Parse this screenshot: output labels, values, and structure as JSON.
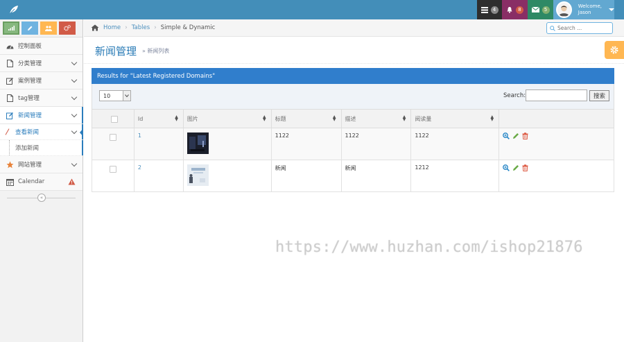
{
  "navbar": {
    "tasks_count": "4",
    "notifications_count": "8",
    "messages_count": "5",
    "welcome_label": "Welcome,",
    "user_name": "Jason",
    "colors": {
      "bar": "#438eb9",
      "tasks": "#2e2e2e",
      "notifications": "#892e65",
      "messages": "#2e8965",
      "user": "#62a8d1"
    }
  },
  "sidebar": {
    "shortcuts": [
      {
        "icon": "signal-icon",
        "color": "#87b87f"
      },
      {
        "icon": "pencil-icon",
        "color": "#6fb3e0"
      },
      {
        "icon": "users-icon",
        "color": "#ffb752"
      },
      {
        "icon": "cogs-icon",
        "color": "#d15b47"
      }
    ],
    "items": [
      {
        "label": "控制面板",
        "icon": "dashboard-icon"
      },
      {
        "label": "分类管理",
        "icon": "file-icon"
      },
      {
        "label": "案例管理",
        "icon": "edit-icon"
      },
      {
        "label": "tag管理",
        "icon": "file-icon"
      },
      {
        "label": "新闻管理",
        "icon": "edit-icon"
      },
      {
        "label": "网站管理",
        "icon": "star-icon"
      },
      {
        "label": "Calendar",
        "icon": "calendar-icon"
      }
    ],
    "sub_items": [
      {
        "label": "查看新闻"
      },
      {
        "label": "添加新闻"
      }
    ],
    "collapse_label": "«"
  },
  "breadcrumb": {
    "home": "Home",
    "tables": "Tables",
    "current": "Simple & Dynamic",
    "separator": "›"
  },
  "search": {
    "placeholder": "Search ..."
  },
  "page": {
    "title": "新闻管理",
    "subtitle": "» 新闻列表"
  },
  "table": {
    "header_title": "Results for \"Latest Registered Domains\"",
    "page_length": "10",
    "search_label": "Search:",
    "search_button": "搜索",
    "columns": [
      "Id",
      "图片",
      "标题",
      "描述",
      "阅读量"
    ],
    "rows": [
      {
        "id": "1",
        "title": "1122",
        "description": "1122",
        "views": "1122"
      },
      {
        "id": "2",
        "title": "新闻",
        "description": "新闻",
        "views": "1212"
      }
    ]
  },
  "watermark": "https://www.huzhan.com/ishop21876"
}
